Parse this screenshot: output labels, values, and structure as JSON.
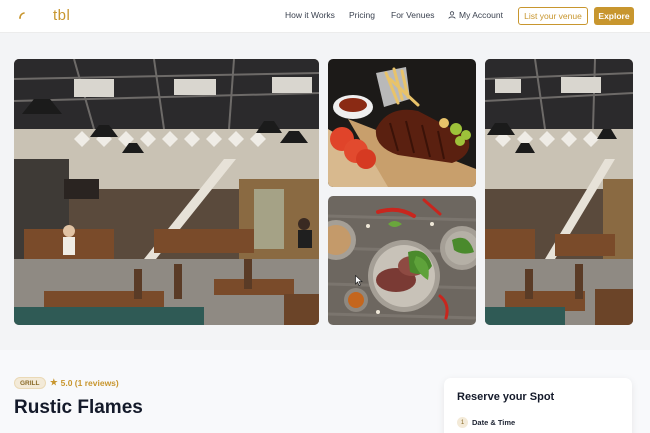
{
  "header": {
    "logo_text": "tbl",
    "nav": {
      "how_it_works": "How it Works",
      "pricing": "Pricing",
      "for_venues": "For Venues",
      "my_account": "My Account"
    },
    "list_venue_label": "List your venue",
    "explore_label": "Explore"
  },
  "gallery": {
    "photos": [
      {
        "name": "restaurant-interior"
      },
      {
        "name": "ribs-dish"
      },
      {
        "name": "salad-dish"
      },
      {
        "name": "restaurant-interior"
      }
    ]
  },
  "venue": {
    "category": "GRILL",
    "rating": "5.0 (1 reviews)",
    "name": "Rustic Flames"
  },
  "reserve": {
    "title": "Reserve your Spot",
    "step_number": "1",
    "step_label": "Date & Time"
  },
  "colors": {
    "accent": "#c8962e",
    "text": "#1e2433",
    "badge_bg": "#f3ead8"
  },
  "icons": [
    "logo-mark-icon",
    "user-icon",
    "star-icon",
    "cursor-icon"
  ]
}
